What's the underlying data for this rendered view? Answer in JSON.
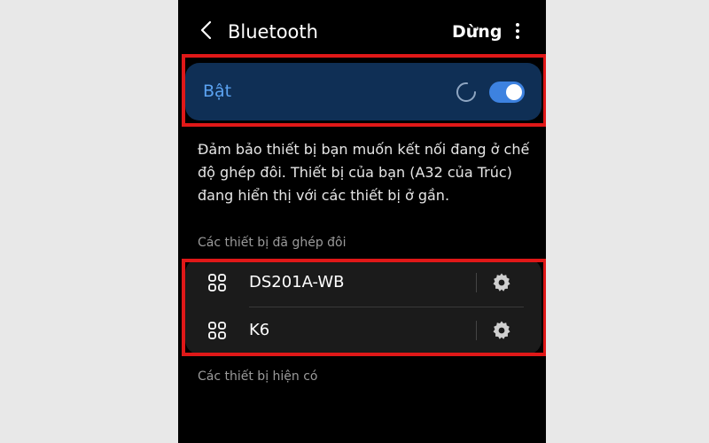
{
  "header": {
    "title": "Bluetooth",
    "stop_label": "Dừng",
    "back_icon": "chevron-left-icon",
    "more_icon": "more-vertical-icon"
  },
  "toggle_card": {
    "label": "Bật",
    "state": "on",
    "scanning": true,
    "accent_color": "#3d82e0"
  },
  "description": "Đảm bảo thiết bị bạn muốn kết nối đang ở chế độ ghép đôi. Thiết bị của bạn (A32 của Trúc) đang hiển thị với các thiết bị ở gần.",
  "paired": {
    "section_label": "Các thiết bị đã ghép đôi",
    "devices": [
      {
        "name": "DS201A-WB",
        "icon": "device-grid-icon",
        "settings_icon": "gear-icon"
      },
      {
        "name": "K6",
        "icon": "device-grid-icon",
        "settings_icon": "gear-icon"
      }
    ]
  },
  "available": {
    "section_label": "Các thiết bị hiện có"
  },
  "highlight_color": "#e01818"
}
